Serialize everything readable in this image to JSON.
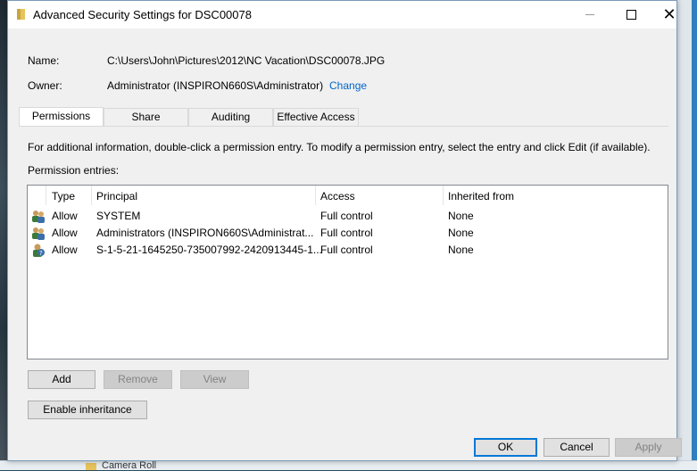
{
  "window": {
    "title": "Advanced Security Settings for DSC00078"
  },
  "name": {
    "label": "Name:",
    "value": "C:\\Users\\John\\Pictures\\2012\\NC Vacation\\DSC00078.JPG"
  },
  "owner": {
    "label": "Owner:",
    "value": "Administrator (INSPIRON660S\\Administrator)",
    "change_link": "Change"
  },
  "tabs": [
    {
      "label": "Permissions",
      "active": true
    },
    {
      "label": "Share",
      "active": false
    },
    {
      "label": "Auditing",
      "active": false
    },
    {
      "label": "Effective Access",
      "active": false
    }
  ],
  "permissions": {
    "info_text": "For additional information, double-click a permission entry. To modify a permission entry, select the entry and click Edit (if available).",
    "entries_label": "Permission entries:",
    "columns": [
      "Type",
      "Principal",
      "Access",
      "Inherited from"
    ],
    "rows": [
      {
        "icon": "users-icon",
        "type": "Allow",
        "principal": "SYSTEM",
        "access": "Full control",
        "inherited": "None"
      },
      {
        "icon": "users-icon",
        "type": "Allow",
        "principal": "Administrators (INSPIRON660S\\Administrat...",
        "access": "Full control",
        "inherited": "None"
      },
      {
        "icon": "unknown-user-icon",
        "type": "Allow",
        "principal": "S-1-5-21-1645250-735007992-2420913445-1...",
        "access": "Full control",
        "inherited": "None"
      }
    ],
    "buttons": {
      "add": "Add",
      "remove": "Remove",
      "view": "View",
      "enable_inheritance": "Enable inheritance"
    }
  },
  "footer": {
    "ok": "OK",
    "cancel": "Cancel",
    "apply": "Apply"
  },
  "background": {
    "explorer_item": "Camera Roll"
  },
  "colors": {
    "link": "#0066cc",
    "default_button_border": "#0078d7",
    "folder": "#e6c25a"
  }
}
